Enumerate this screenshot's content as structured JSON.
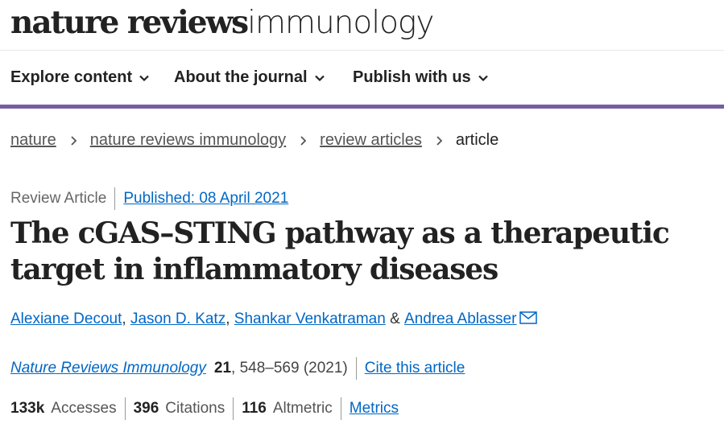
{
  "brand": {
    "part1": "nature reviews",
    "part2": "immunology"
  },
  "nav": {
    "items": [
      {
        "label": "Explore content"
      },
      {
        "label": "About the journal"
      },
      {
        "label": "Publish with us"
      }
    ],
    "accent_color": "#735fa2"
  },
  "breadcrumb": [
    {
      "label": "nature"
    },
    {
      "label": "nature reviews immunology"
    },
    {
      "label": "review articles"
    },
    {
      "label": "article"
    }
  ],
  "article": {
    "type": "Review Article",
    "published": "Published: 08 April 2021",
    "title": "The cGAS–STING pathway as a therapeutic target in inflammatory diseases",
    "authors": [
      {
        "name": "Alexiane Decout",
        "after": ", "
      },
      {
        "name": "Jason D. Katz",
        "after": ", "
      },
      {
        "name": "Shankar Venkatraman",
        "after": " & "
      },
      {
        "name": "Andrea Ablasser",
        "after": ""
      }
    ],
    "journal": "Nature Reviews Immunology",
    "volume": "21",
    "pages_year": ", 548–569 (2021)",
    "cite_label": "Cite this article"
  },
  "metrics": {
    "accesses_value": "133k",
    "accesses_label": "Accesses",
    "citations_value": "396",
    "citations_label": "Citations",
    "altmetric_value": "116",
    "altmetric_label": "Altmetric",
    "metrics_link": "Metrics"
  },
  "colors": {
    "link": "#0067c5",
    "text": "#222222"
  },
  "icons": {
    "chevron": "chevron-down-icon",
    "separator": "chevron-right-icon",
    "mail": "envelope-icon"
  }
}
